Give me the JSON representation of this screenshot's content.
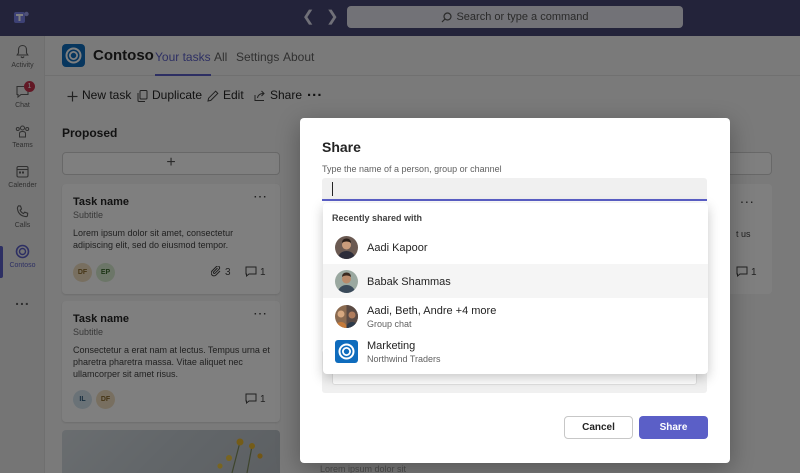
{
  "topbar": {
    "search_placeholder": "Search or type a command"
  },
  "rail": {
    "items": [
      {
        "label": "Activity",
        "icon": "bell-icon"
      },
      {
        "label": "Chat",
        "icon": "chat-icon",
        "badge": "1"
      },
      {
        "label": "Teams",
        "icon": "teams-icon"
      },
      {
        "label": "Calender",
        "icon": "calendar-icon"
      },
      {
        "label": "Calls",
        "icon": "phone-icon"
      },
      {
        "label": "Contoso",
        "icon": "contoso-icon"
      }
    ],
    "more": "..."
  },
  "app": {
    "name": "Contoso",
    "tabs": [
      "Your tasks",
      "All",
      "Settings",
      "About"
    ]
  },
  "toolbar": {
    "new_task": "New task",
    "duplicate": "Duplicate",
    "edit": "Edit",
    "share": "Share",
    "more": "..."
  },
  "board": {
    "column_title": "Proposed",
    "add": "+",
    "cards": [
      {
        "name": "Task name",
        "subtitle": "Subtitle",
        "description": "Lorem ipsum dolor sit amet, consectetur adipiscing elit, sed do eiusmod tempor.",
        "avatars": [
          "DF",
          "EP"
        ],
        "attachments": "3",
        "comments": "1"
      },
      {
        "name": "Task name",
        "subtitle": "Subtitle",
        "description": "Consectetur a erat nam at lectus. Tempus urna et pharetra pharetra massa. Vitae aliquet nec ullamcorper sit amet risus.",
        "avatars": [
          "IL",
          "DF"
        ],
        "comments": "1"
      }
    ],
    "right_column": {
      "more": "...",
      "text": "t us",
      "comments": "1"
    }
  },
  "dialog": {
    "title": "Share",
    "input_label": "Type the name of a person, group or channel",
    "input_value": "",
    "cancel": "Cancel",
    "share": "Share",
    "behind_text": "Lorem ipsum dolor sit"
  },
  "dropdown": {
    "heading": "Recently shared with",
    "items": [
      {
        "name": "Aadi Kapoor",
        "subtitle": ""
      },
      {
        "name": "Babak Shammas",
        "subtitle": ""
      },
      {
        "name": "Aadi, Beth, Andre +4 more",
        "subtitle": "Group chat"
      },
      {
        "name": "Marketing",
        "subtitle": "Northwind Traders"
      }
    ]
  },
  "colors": {
    "topbar": "#464775",
    "accent": "#5b5fc7",
    "brand_blue": "#0f6cbd",
    "badge": "#c4314b"
  }
}
